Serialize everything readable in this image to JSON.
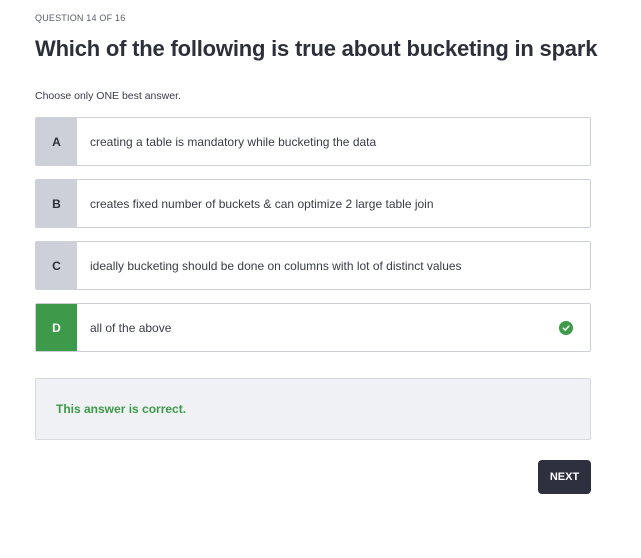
{
  "question": {
    "counter": "QUESTION 14 OF 16",
    "title": "Which of the following is true about bucketing in spark",
    "instruction": "Choose only ONE best answer."
  },
  "options": [
    {
      "letter": "A",
      "text": "creating a table is mandatory while bucketing the data",
      "selected": false,
      "correct": false
    },
    {
      "letter": "B",
      "text": "creates fixed number of buckets & can optimize 2 large table join",
      "selected": false,
      "correct": false
    },
    {
      "letter": "C",
      "text": "ideally bucketing should be done on columns with lot of distinct values",
      "selected": false,
      "correct": false
    },
    {
      "letter": "D",
      "text": "all of the above",
      "selected": true,
      "correct": true
    }
  ],
  "feedback": {
    "message": "This answer is correct."
  },
  "actions": {
    "next_label": "NEXT"
  },
  "colors": {
    "correct_green": "#3d9a4a",
    "letter_bg": "#cdd0d8",
    "button_bg": "#2e3040",
    "feedback_bg": "#eff1f4"
  }
}
